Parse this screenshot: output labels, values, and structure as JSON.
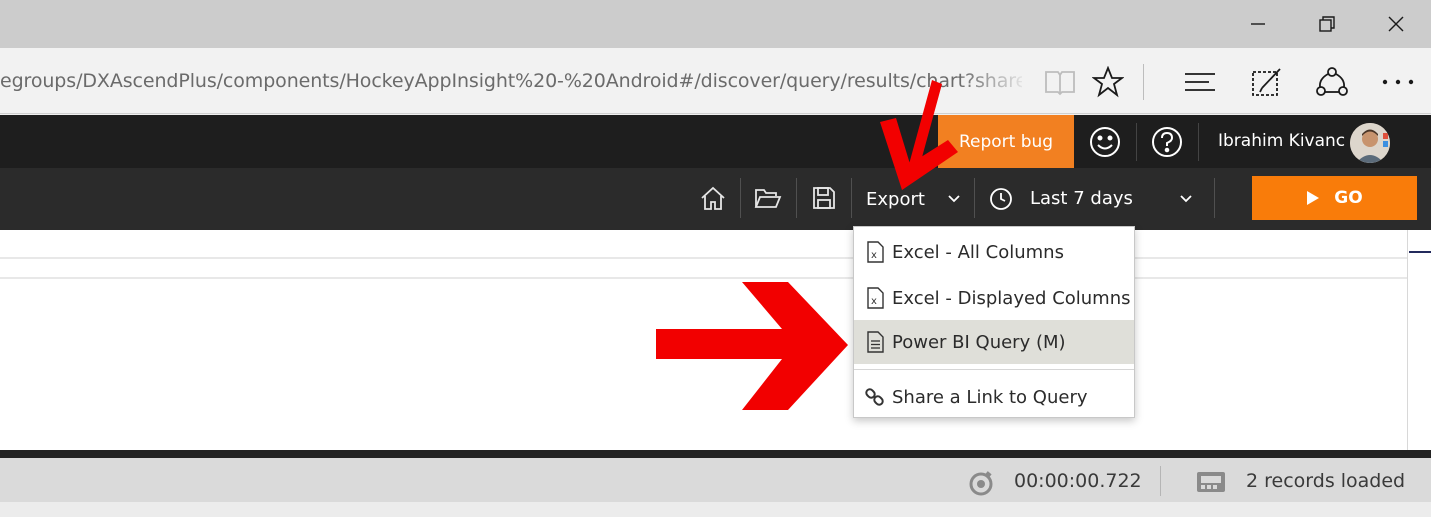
{
  "browser": {
    "url": "egroups/DXAscendPlus/components/HockeyAppInsight%20-%20Android#/discover/query/results/chart?shared=false&",
    "window_buttons": [
      "minimize-icon",
      "restore-icon",
      "close-icon"
    ],
    "toolbar_icons": [
      "reading-view-icon",
      "favorites-star-icon",
      "hub-icon",
      "web-note-icon",
      "share-icon",
      "more-icon"
    ]
  },
  "header": {
    "report_bug_label": "Report bug",
    "feedback_icon": "smiley-icon",
    "help_icon": "help-icon",
    "user_name": "Ibrahim Kivanc",
    "accent_color": "#f28021"
  },
  "toolbar": {
    "icons": [
      "home-icon",
      "open-folder-icon",
      "save-icon"
    ],
    "export_label": "Export",
    "time_range_label": "Last 7 days",
    "go_label": "GO",
    "go_color": "#f97c0a"
  },
  "export_menu": {
    "items": [
      {
        "label": "Excel - All Columns",
        "icon": "excel-icon"
      },
      {
        "label": "Excel - Displayed Columns",
        "icon": "excel-icon"
      },
      {
        "label": "Power BI Query (M)",
        "icon": "document-icon",
        "selected": true
      },
      {
        "label": "Share a Link to Query",
        "icon": "link-icon"
      }
    ]
  },
  "status": {
    "elapsed_time": "00:00:00.722",
    "records_text": "2 records loaded"
  },
  "annotations": {
    "arrow_color": "#f20000"
  }
}
